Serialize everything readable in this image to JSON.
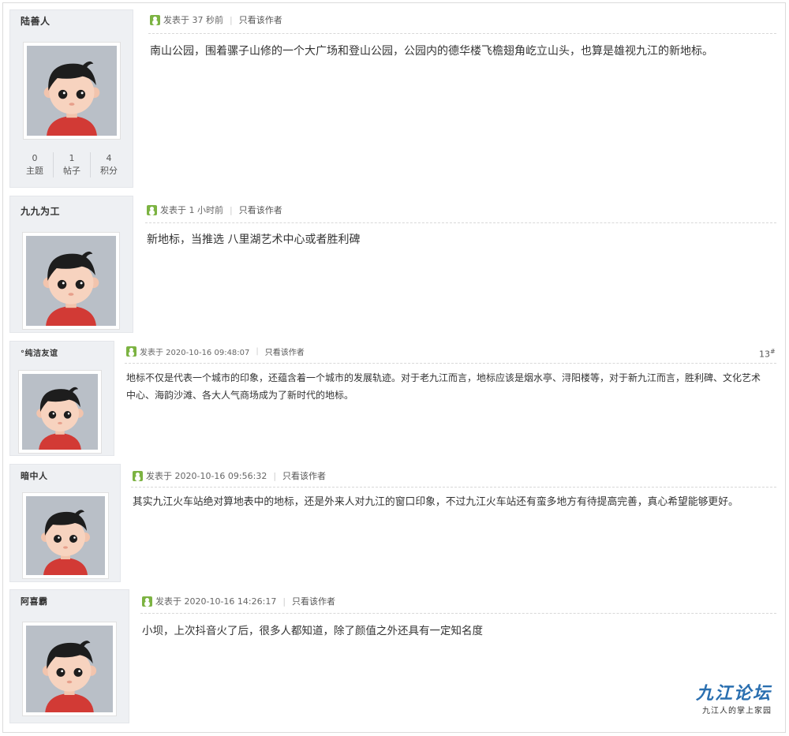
{
  "posts": [
    {
      "username": "陆善人",
      "time": "发表于 37 秒前",
      "author_only": "只看该作者",
      "content": "南山公园，围着骡子山修的一个大广场和登山公园，公园内的德华楼飞檐翅角屹立山头，也算是雄视九江的新地标。",
      "stats": [
        {
          "value": "0",
          "label": "主题"
        },
        {
          "value": "1",
          "label": "帖子"
        },
        {
          "value": "4",
          "label": "积分"
        }
      ]
    },
    {
      "username": "九九为工",
      "time": "发表于 1 小时前",
      "author_only": "只看该作者",
      "content": "新地标，当推选 八里湖艺术中心或者胜利碑"
    },
    {
      "username": "°纯洁友谊",
      "time": "发表于 2020-10-16 09:48:07",
      "author_only": "只看该作者",
      "floor": "13",
      "floor_suffix": "#",
      "content": "地标不仅是代表一个城市的印象，还蕴含着一个城市的发展轨迹。对于老九江而言，地标应该是烟水亭、浔阳楼等，对于新九江而言，胜利碑、文化艺术中心、海韵沙滩、各大人气商场成为了新时代的地标。"
    },
    {
      "username": "暗中人",
      "time": "发表于 2020-10-16 09:56:32",
      "author_only": "只看该作者",
      "content": "其实九江火车站绝对算地表中的地标，还是外来人对九江的窗口印象，不过九江火车站还有蛮多地方有待提高完善，真心希望能够更好。"
    },
    {
      "username": "阿喜霸",
      "time": "发表于 2020-10-16 14:26:17",
      "author_only": "只看该作者",
      "content": "小坝，上次抖音火了后，很多人都知道，除了颜值之外还具有一定知名度"
    }
  ],
  "watermark": {
    "logo": "九江论坛",
    "slogan": "九江人的掌上家园"
  },
  "colors": {
    "accent": "#7cb342",
    "logo": "#2a6fb0"
  }
}
